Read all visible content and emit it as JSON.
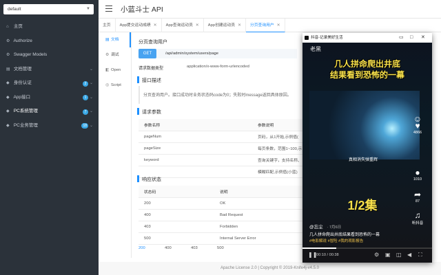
{
  "sidebar": {
    "select_value": "default",
    "items": [
      {
        "label": "主页",
        "icon": "home-icon",
        "glyph": "⌂"
      },
      {
        "label": "Authorize",
        "icon": "lock-icon",
        "glyph": "⚙"
      },
      {
        "label": "Swagger Models",
        "icon": "model-icon",
        "glyph": "⚙"
      },
      {
        "label": "文档管理",
        "icon": "doc-icon",
        "glyph": "▤"
      },
      {
        "label": "身份认证",
        "icon": "tag-icon",
        "glyph": "◆",
        "badge": "2"
      },
      {
        "label": "App接口",
        "icon": "tag-icon",
        "glyph": "◆",
        "badge": "1"
      },
      {
        "label": "PC系统管理",
        "icon": "tag-icon",
        "glyph": "◆",
        "badge": "7"
      },
      {
        "label": "PC业务管理",
        "icon": "tag-icon",
        "glyph": "◆",
        "badge": "18"
      }
    ]
  },
  "header": {
    "title": "小蓝斗士 API"
  },
  "tabs": [
    {
      "label": "主页"
    },
    {
      "label": "App提交运动成绩"
    },
    {
      "label": "App查询运动员"
    },
    {
      "label": "App创建运动员"
    },
    {
      "label": "分页查询用户"
    }
  ],
  "subnav": [
    {
      "label": "文档",
      "glyph": "▤"
    },
    {
      "label": "调试",
      "glyph": "⚙"
    },
    {
      "label": "Open",
      "glyph": "◧"
    },
    {
      "label": "Script",
      "glyph": "◎"
    }
  ],
  "doc": {
    "title": "分页查询用户",
    "method": "GET",
    "url": "/api/admin/system/users/page",
    "content_type_label": "请求数据类型",
    "content_type_value": "application/x-www-form-urlencoded",
    "desc_title": "接口描述",
    "desc_text": "分页查询用户。接口成功时业务状态码code为0；失败时message返回具体原因。",
    "params_title": "请求参数",
    "params_headers": [
      "参数名称",
      "参数说明"
    ],
    "params": [
      {
        "name": "pageNum",
        "desc": "页码，从1开始,示例值("
      },
      {
        "name": "pageSize",
        "desc": "每页条数，范围1~100,示"
      },
      {
        "name": "keyword",
        "desc": "查询关键字，支持名称、"
      },
      {
        "name": "",
        "desc": "模糊匹配,示例值(小蓝)"
      }
    ],
    "resp_title": "响应状态",
    "resp_headers": [
      "状态码",
      "说明"
    ],
    "resp": [
      {
        "code": "200",
        "desc": "OK"
      },
      {
        "code": "400",
        "desc": "Bad Request"
      },
      {
        "code": "403",
        "desc": "Forbidden"
      },
      {
        "code": "500",
        "desc": "Internal Server Error"
      }
    ],
    "code_tabs": [
      "200",
      "400",
      "403",
      "500"
    ]
  },
  "footer": {
    "text": "Apache License 2.0 | Copyright © 2019-Knife4j-v4.5.0"
  },
  "player": {
    "window_title": "抖音-记录美好生活",
    "author": "老黑",
    "headline_1": "几人拼命爬出井底",
    "headline_2": "结果看到恐怖的一幕",
    "scene_caption": "真相消失弹重辉",
    "episode": "1/2集",
    "likes": "4866",
    "comments": "1010",
    "shares": "87",
    "listen": "听抖音",
    "user": "@忘尘",
    "date": "· 7月6日",
    "caption": "几人拼命爬出井底结果看到恐怖的一幕",
    "tags": "#电影解说 #冒险 #我的观影报告",
    "time": "00:10 / 00:38",
    "progress": 0.26
  }
}
